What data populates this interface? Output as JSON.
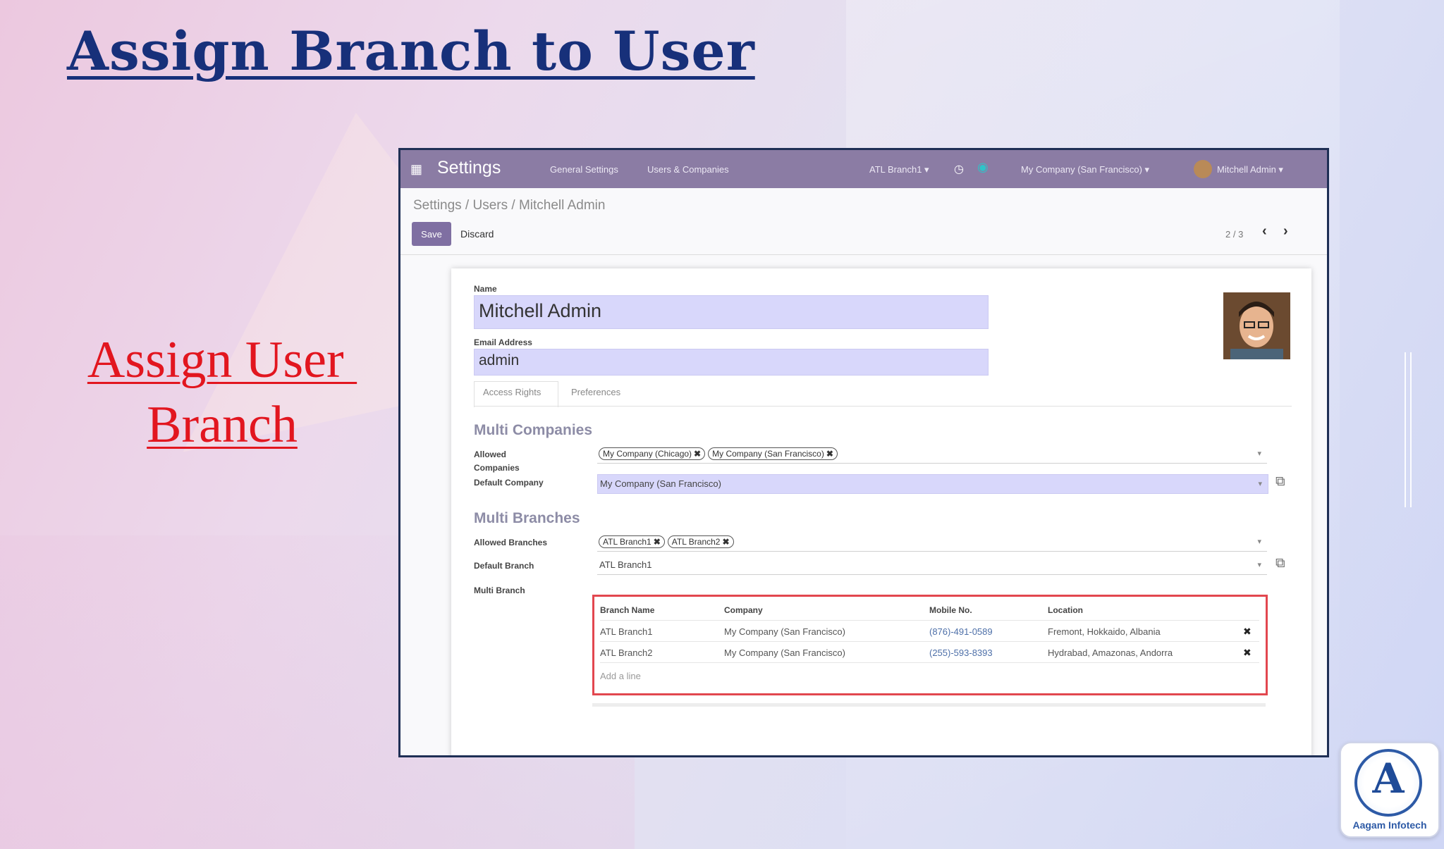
{
  "slide": {
    "title": "Assign Branch to User",
    "caption_line1": "Assign User ",
    "caption_line2": "Branch",
    "logo_text": "Aagam Infotech"
  },
  "app": {
    "title": "Settings",
    "nav": [
      "General Settings",
      "Users & Companies"
    ],
    "branch_switch": "ATL Branch1 ▾",
    "company_switch": "My Company (San Francisco) ▾",
    "user_menu": "Mitchell Admin ▾",
    "breadcrumb": "Settings / Users / Mitchell Admin",
    "save_label": "Save",
    "discard_label": "Discard",
    "pager": "2 / 3"
  },
  "form": {
    "name_label": "Name",
    "name_value": "Mitchell Admin",
    "email_label": "Email Address",
    "email_value": "admin",
    "tabs": [
      "Access Rights",
      "Preferences"
    ],
    "multi_companies": {
      "title": "Multi Companies",
      "allowed_label": "Allowed Companies",
      "allowed_tags": [
        "My Company (Chicago)",
        "My Company (San Francisco)"
      ],
      "default_label": "Default Company",
      "default_value": "My Company (San Francisco)"
    },
    "multi_branches": {
      "title": "Multi Branches",
      "allowed_label": "Allowed Branches",
      "allowed_tags": [
        "ATL Branch1",
        "ATL Branch2"
      ],
      "default_label": "Default Branch",
      "default_value": "ATL Branch1",
      "multi_label": "Multi Branch"
    },
    "branch_table": {
      "headers": [
        "Branch Name",
        "Company",
        "Mobile No.",
        "Location"
      ],
      "rows": [
        [
          "ATL Branch1",
          "My Company (San Francisco)",
          "(876)-491-0589",
          "Fremont, Hokkaido, Albania"
        ],
        [
          "ATL Branch2",
          "My Company (San Francisco)",
          "(255)-593-8393",
          "Hydrabad, Amazonas, Andorra"
        ]
      ],
      "add_line": "Add a line"
    }
  },
  "icons": {
    "menu": "grid-icon",
    "clock": "clock-icon",
    "chat": "chat-icon",
    "prev": "chevron-left-icon",
    "next": "chevron-right-icon",
    "remove": "close-icon",
    "external": "external-link-icon",
    "dropdown": "caret-down-icon"
  },
  "colors": {
    "title_blue": "#17307a",
    "caption_red": "#e2161f",
    "topbar": "#8b7ca4",
    "field_highlight": "#d8d7fb",
    "table_border": "#e2474f"
  }
}
